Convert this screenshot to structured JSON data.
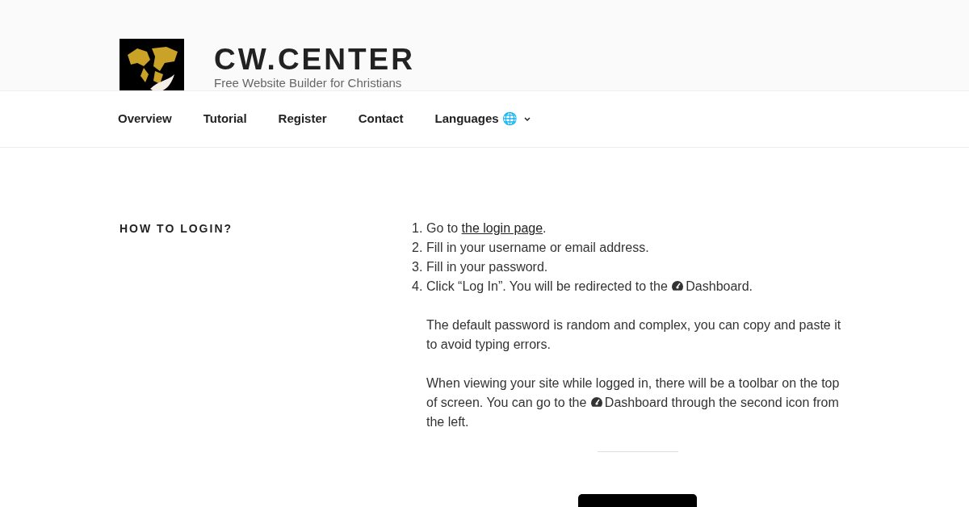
{
  "site": {
    "title": "CW.CENTER",
    "tagline": "Free Website Builder for Christians"
  },
  "nav": [
    {
      "label": "Overview",
      "kind": "link"
    },
    {
      "label": "Tutorial",
      "kind": "link"
    },
    {
      "label": "Register",
      "kind": "link"
    },
    {
      "label": "Contact",
      "kind": "link"
    },
    {
      "label": "Languages 🌐",
      "kind": "dropdown"
    }
  ],
  "section": {
    "heading": "HOW TO LOGIN?",
    "steps": [
      {
        "number": "1.",
        "segments": [
          {
            "kind": "text",
            "text": "Go to "
          },
          {
            "kind": "link",
            "text": "the login page"
          },
          {
            "kind": "text",
            "text": "."
          }
        ]
      },
      {
        "number": "2.",
        "segments": [
          {
            "kind": "text",
            "text": "Fill in your username or email address."
          }
        ]
      },
      {
        "number": "3.",
        "segments": [
          {
            "kind": "text",
            "text": "Fill in your password."
          }
        ]
      },
      {
        "number": "4.",
        "segments": [
          {
            "kind": "text",
            "text": "Click “Log In”. You will be redirected to the "
          },
          {
            "kind": "icon"
          },
          {
            "kind": "text",
            "text": "Dashboard."
          }
        ]
      }
    ],
    "notes": [
      {
        "segments": [
          {
            "kind": "text",
            "text": "The default password is random and complex, you can copy and paste it to avoid typing errors."
          }
        ]
      },
      {
        "segments": [
          {
            "kind": "text",
            "text": "When viewing your site while logged in, there will be a toolbar on the top of screen. You can go to the "
          },
          {
            "kind": "icon"
          },
          {
            "kind": "text",
            "text": "Dashboard through the second icon from the left."
          }
        ]
      }
    ]
  }
}
